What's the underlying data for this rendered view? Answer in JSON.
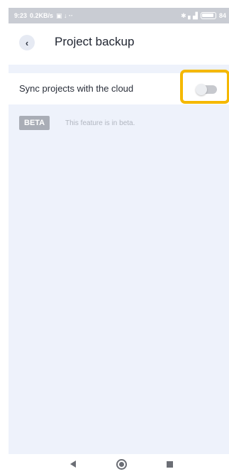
{
  "status_bar": {
    "time": "9:23",
    "network_speed": "0.2KB/s",
    "extra_icons": "▣ ↓ ··",
    "right_icons": "✱ ▖▟",
    "battery": "84"
  },
  "header": {
    "back_glyph": "‹",
    "title": "Project backup"
  },
  "settings": {
    "sync": {
      "label": "Sync projects with the cloud",
      "enabled": false
    },
    "beta": {
      "badge": "BETA",
      "text": "This feature is in beta."
    }
  },
  "colors": {
    "screen_bg": "#eef2fb",
    "highlight": "#f5b800",
    "badge_bg": "#a9adb6"
  },
  "nav_bar": {
    "icons": [
      "back-triangle-icon",
      "home-circle-icon",
      "recents-square-icon"
    ]
  }
}
